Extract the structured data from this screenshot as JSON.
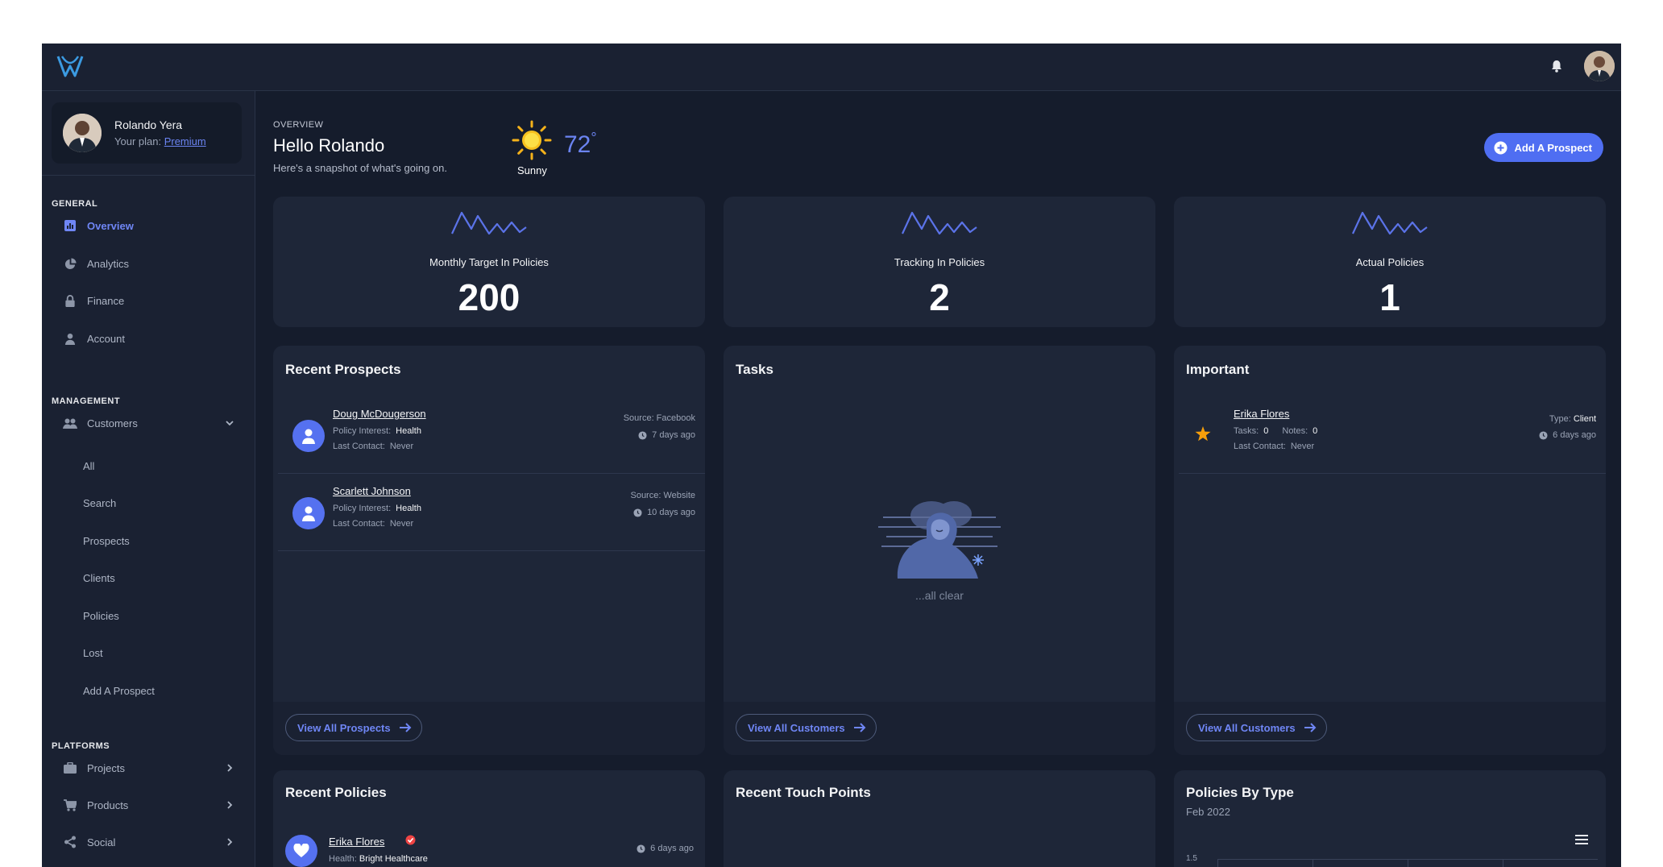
{
  "user": {
    "name": "Rolando Yera",
    "plan_label": "Your plan:",
    "plan": "Premium"
  },
  "sidebar": {
    "general_title": "GENERAL",
    "general": [
      "Overview",
      "Analytics",
      "Finance",
      "Account"
    ],
    "management_title": "MANAGEMENT",
    "customers_label": "Customers",
    "customers_sub": [
      "All",
      "Search",
      "Prospects",
      "Clients",
      "Policies",
      "Lost",
      "Add A Prospect"
    ],
    "platforms_title": "PLATFORMS",
    "platforms": [
      "Projects",
      "Products",
      "Social"
    ]
  },
  "header": {
    "overview_label": "OVERVIEW",
    "greeting": "Hello Rolando",
    "subtitle": "Here's a snapshot of what's going on.",
    "temperature": "72",
    "degree": "°",
    "weather": "Sunny",
    "add_prospect": "Add A Prospect"
  },
  "stats": [
    {
      "title": "Monthly Target In Policies",
      "value": "200"
    },
    {
      "title": "Tracking In Policies",
      "value": "2"
    },
    {
      "title": "Actual Policies",
      "value": "1"
    }
  ],
  "recent_prospects": {
    "title": "Recent Prospects",
    "items": [
      {
        "name": "Doug McDougerson",
        "interest_label": "Policy Interest:",
        "interest": "Health",
        "contact_label": "Last Contact:",
        "contact": "Never",
        "source": "Source: Facebook",
        "ago": "7 days ago"
      },
      {
        "name": "Scarlett Johnson",
        "interest_label": "Policy Interest:",
        "interest": "Health",
        "contact_label": "Last Contact:",
        "contact": "Never",
        "source": "Source: Website",
        "ago": "10 days ago"
      }
    ],
    "button": "View All Prospects"
  },
  "tasks": {
    "title": "Tasks",
    "empty": "...all clear",
    "button": "View All Customers"
  },
  "important": {
    "title": "Important",
    "item": {
      "name": "Erika Flores",
      "tasks_label": "Tasks:",
      "tasks": "0",
      "notes_label": "Notes:",
      "notes": "0",
      "contact_label": "Last Contact:",
      "contact": "Never",
      "type_label": "Type:",
      "type": "Client",
      "ago": "6 days ago"
    },
    "button": "View All Customers"
  },
  "recent_policies": {
    "title": "Recent Policies",
    "item": {
      "name": "Erika Flores",
      "detail_label": "Health:",
      "detail": "Bright Healthcare",
      "ago": "6 days ago"
    }
  },
  "touch_points": {
    "title": "Recent Touch Points"
  },
  "policies_by_type": {
    "title": "Policies By Type",
    "subtitle": "Feb 2022",
    "y_tick": "1.5"
  },
  "colors": {
    "accent": "#4f6ef2",
    "background": "#151c2c",
    "card": "#1e2638",
    "star": "#f59e0b",
    "verified": "#ef4444"
  }
}
